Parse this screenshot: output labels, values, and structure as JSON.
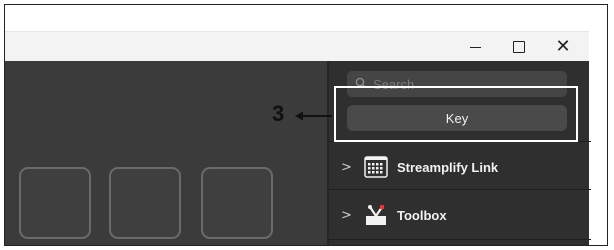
{
  "window_controls": {
    "minimize": "—",
    "maximize": "☐",
    "close": "✕"
  },
  "search": {
    "placeholder": "Search",
    "icon": "search-icon"
  },
  "key_button": {
    "label": "Key"
  },
  "plugins": [
    {
      "label": "Streamplify Link",
      "icon": "keypad-icon",
      "expanded": false
    },
    {
      "label": "Toolbox",
      "icon": "toolbox-icon",
      "expanded": false
    }
  ],
  "annotation": {
    "number": "3"
  },
  "colors": {
    "app_background": "#3b3b3b",
    "sidebar_background": "#2f2f2f",
    "highlight_border": "#ffffff"
  }
}
